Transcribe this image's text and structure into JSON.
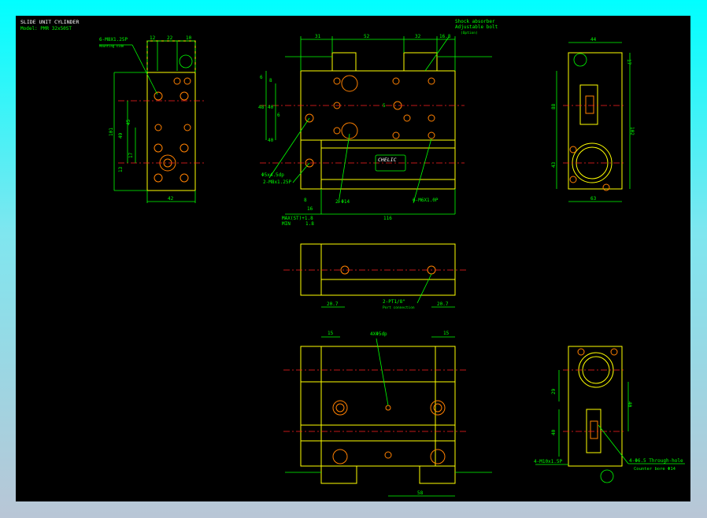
{
  "title": "SLIDE UNIT CYLINDER",
  "model": "Model: PMR 32x50ST",
  "colors": {
    "outline": "#ffff00",
    "dimension": "#00ff00",
    "centerline": "#ff2020",
    "hole": "#ff8000",
    "background": "#000000"
  },
  "left_view": {
    "callout": "6-M8X1.25P",
    "callout_sub": "Mounting side",
    "top_dims": [
      "12",
      "22",
      "10"
    ],
    "side_dims": [
      "101",
      "45",
      "49",
      "17",
      "13"
    ],
    "bottom_dim": "42"
  },
  "front_view": {
    "top_dims": [
      "31",
      "52",
      "32",
      "16.8"
    ],
    "side_dims": [
      "6",
      "8",
      "48",
      "40",
      "6",
      "40"
    ],
    "port_legend": [
      "Shock absorber",
      "Adjustable bolt"
    ],
    "port_legend_sub": "(Option)",
    "callouts": [
      "Φ5x4.5dp",
      "2-M8x1.25P",
      "2-Φ14",
      "6-M6X1.0P"
    ],
    "small_dims": [
      "8",
      "16",
      "5"
    ],
    "stroke_label": "MAX(ST)+1.8",
    "min_label": "MIN",
    "min_value": "1.8",
    "length": "116",
    "logo": "CHELIC"
  },
  "right_view": {
    "top_dim": "44",
    "side_dims": [
      "17",
      "88",
      "102",
      "43"
    ],
    "bottom_dim": "63"
  },
  "middle_view": {
    "dims": [
      "20.7",
      "20.7"
    ],
    "callout": "2-PT1/8\"",
    "callout_sub": "Port connection"
  },
  "bottom_view": {
    "dims": [
      "15",
      "15"
    ],
    "callout": "4XΦ5dp",
    "bottom_dim": "58"
  },
  "bottom_right_view": {
    "side_dims": [
      "29",
      "40",
      "40"
    ],
    "callout_left": "4-M10x1.5P",
    "callout_right": "4-Φ6.5 Through-hole",
    "callout_right_sub": "Counter bore Φ14"
  }
}
